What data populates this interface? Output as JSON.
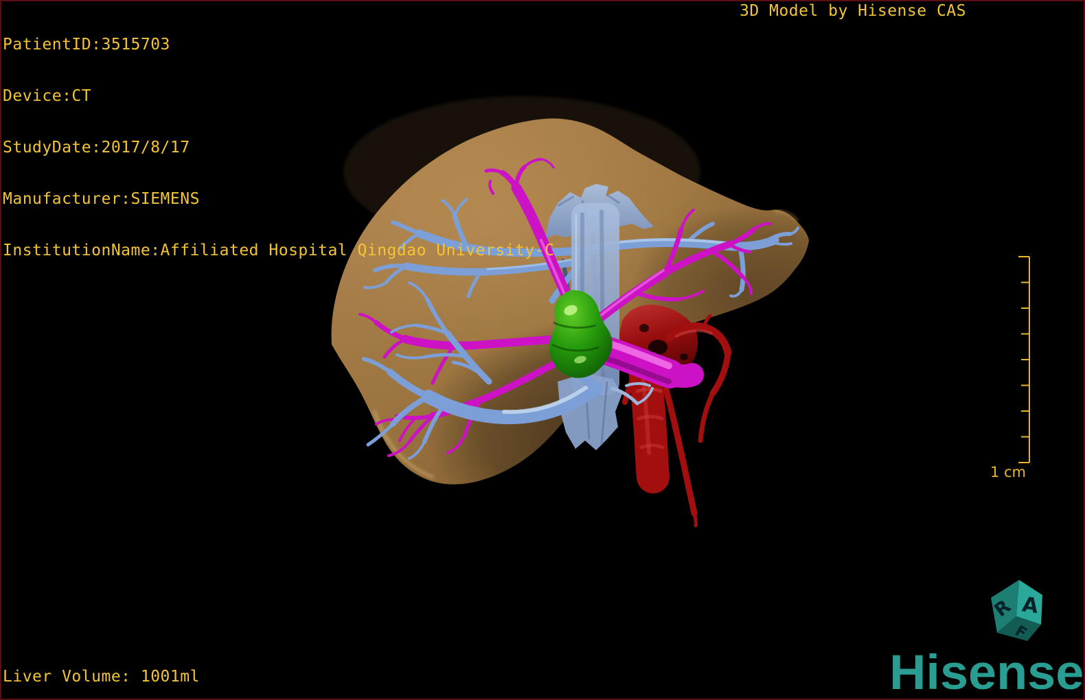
{
  "overlay": {
    "patient": {
      "patient_id": "PatientID:3515703",
      "device": "Device:CT",
      "study_date": "StudyDate:2017/8/17",
      "manufacturer": "Manufacturer:SIEMENS",
      "institution": "InstitutionName:Affiliated Hospital Qingdao University-C"
    },
    "watermark": "3D Model by Hisense CAS",
    "liver_volume": "Liver Volume: 1001ml"
  },
  "scale_bar": {
    "label": "1 cm",
    "tick_count": 9
  },
  "orientation_cube": {
    "anterior_label": "A",
    "right_label": "R",
    "foot_label": "F"
  },
  "brand": {
    "logo_text": "Hisense"
  },
  "colors": {
    "text_yellow": "#f3c435",
    "scale_yellow": "#e8b726",
    "brand_teal": "#2a9d92",
    "border_red": "#5a0e13",
    "background": "#000000",
    "liver_tan": "#9c7440",
    "hepatic_vein_blue": "#7b9fd6",
    "portal_vein_magenta": "#cc12c4",
    "artery_red": "#a30f0f",
    "gallbladder_green": "#1e8c0a",
    "ivc_pale_blue": "#93abd4"
  },
  "structures": [
    {
      "name": "liver",
      "color": "#9c7440"
    },
    {
      "name": "hepatic-veins",
      "color": "#7b9fd6"
    },
    {
      "name": "portal-vein",
      "color": "#cc12c4"
    },
    {
      "name": "hepatic-artery",
      "color": "#a30f0f"
    },
    {
      "name": "gallbladder",
      "color": "#1e8c0a"
    },
    {
      "name": "inferior-vena-cava",
      "color": "#93abd4"
    }
  ]
}
